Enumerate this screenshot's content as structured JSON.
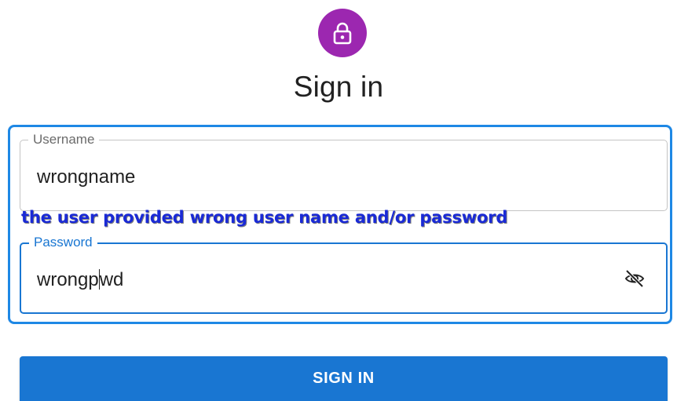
{
  "header": {
    "avatar_icon": "lock-icon",
    "avatar_color": "#9c27b0",
    "title": "Sign in"
  },
  "form": {
    "username": {
      "label": "Username",
      "value": "wrongname"
    },
    "password": {
      "label": "Password",
      "value_before_caret": "wrongp",
      "value_after_caret": "wd",
      "toggle_icon": "eye-off-icon"
    },
    "annotation": "the user provided wrong user name and/or password",
    "submit_label": "SIGN IN"
  },
  "colors": {
    "primary": "#1976d2",
    "annotation_text": "#1a2ad6",
    "frame_highlight": "#1e88e5"
  }
}
